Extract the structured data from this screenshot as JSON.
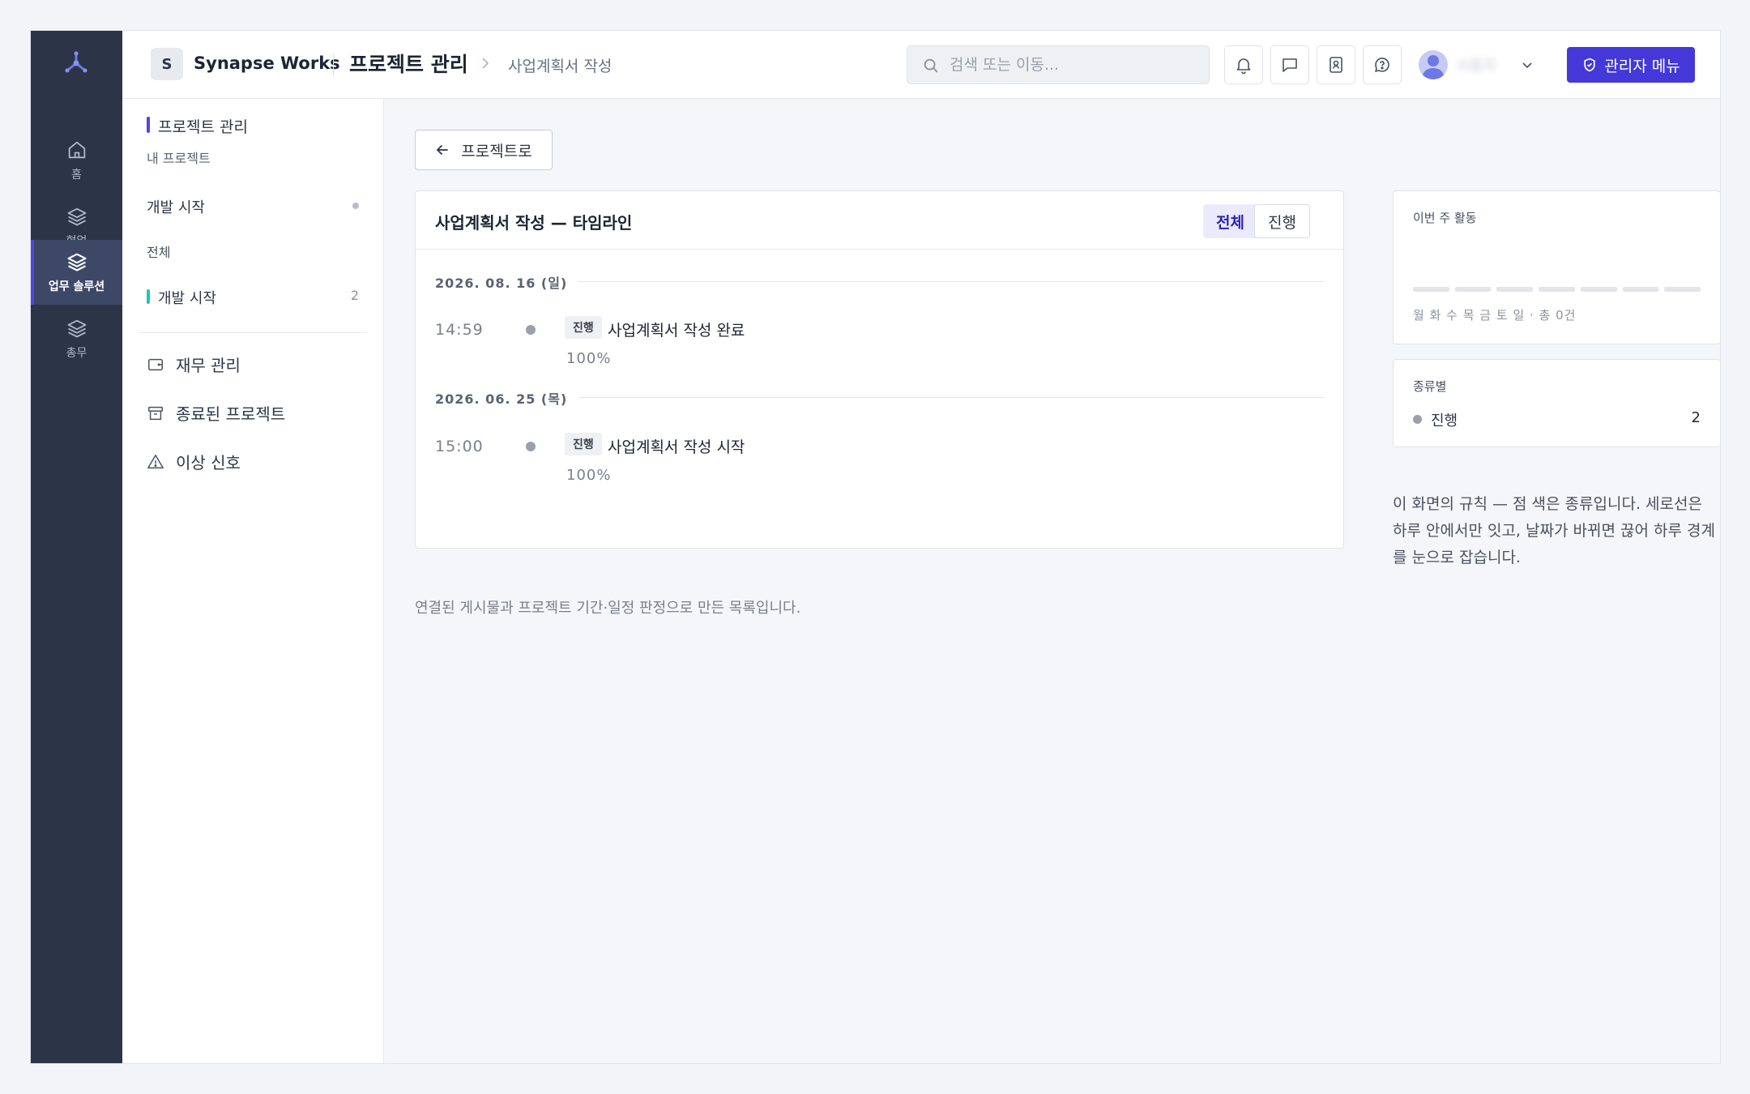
{
  "rail": {
    "items": [
      {
        "label": "홈",
        "icon": "home-icon"
      },
      {
        "label": "협업",
        "icon": "layers-icon"
      },
      {
        "label": "업무 솔루션",
        "icon": "layers-icon",
        "active": true
      },
      {
        "label": "총무",
        "icon": "layers-icon"
      }
    ],
    "accent": "#5046e5"
  },
  "topbar": {
    "workspace_badge": "S",
    "workspace_name": "Synapse Works",
    "page_title": "프로젝트 관리",
    "breadcrumb": "사업계획서 작성",
    "search_placeholder": "검색 또는 이동...",
    "user_name": "사용자",
    "admin_button": "관리자 메뉴",
    "icons": [
      "bell-icon",
      "chat-icon",
      "contacts-icon",
      "help-icon"
    ]
  },
  "sidebar": {
    "title": "프로젝트 관리",
    "subtitle": "내 프로젝트",
    "group": "개발 시작",
    "all": "전체",
    "project": {
      "name": "개발 시작",
      "count": "2"
    },
    "nav": [
      {
        "label": "재무 관리",
        "icon": "wallet-icon"
      },
      {
        "label": "종료된 프로젝트",
        "icon": "archive-icon"
      },
      {
        "label": "이상 신호",
        "icon": "warning-icon"
      }
    ]
  },
  "main": {
    "back_button": "프로젝트로",
    "timeline": {
      "title": "사업계획서 작성 — 타임라인",
      "filters": [
        "전체",
        "진행"
      ],
      "days": [
        {
          "date": "2026. 08. 16 (일)",
          "events": [
            {
              "time": "14:59",
              "tag": "진행",
              "text": "사업계획서 작성 완료",
              "progress": "100%"
            }
          ]
        },
        {
          "date": "2026. 06. 25 (목)",
          "events": [
            {
              "time": "15:00",
              "tag": "진행",
              "text": "사업계획서 작성 시작",
              "progress": "100%"
            }
          ]
        }
      ]
    },
    "footnote": "연결된 게시물과 프로젝트 기간·일정 판정으로 만든 목록입니다."
  },
  "right": {
    "weekly": {
      "title": "이번 주 활동",
      "caption": "월 화 수 목 금 토 일 · 총 0건",
      "values": [
        0,
        0,
        0,
        0,
        0,
        0,
        0
      ]
    },
    "kinds": {
      "title": "종류별",
      "items": [
        {
          "name": "진행",
          "count": "2",
          "color": "#9aa0ac"
        }
      ]
    },
    "rules": "이 화면의 규칙 — 점 색은 종류입니다. 세로선은 하루 안에서만 잇고, 날짜가 바뀌면 끊어 하루 경계를 눈으로 잡습니다."
  }
}
